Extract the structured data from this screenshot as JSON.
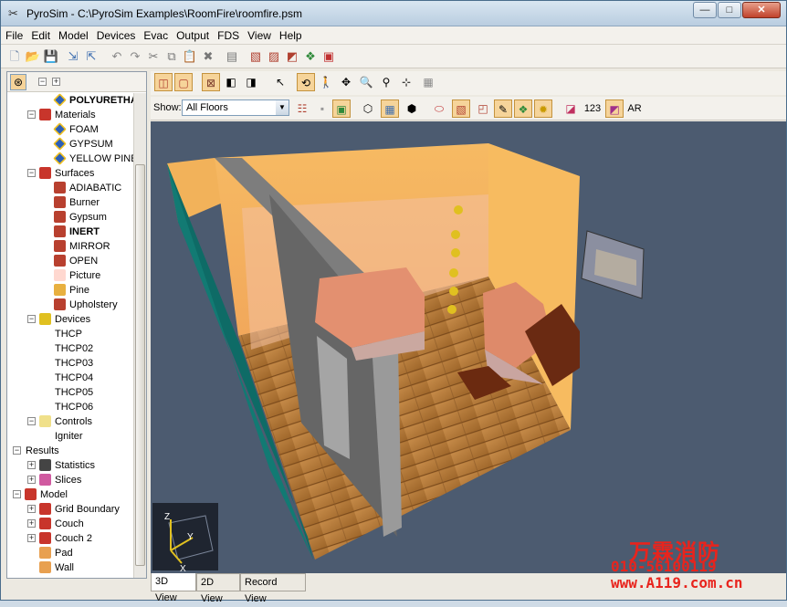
{
  "window": {
    "title": "PyroSim - C:\\PyroSim Examples\\RoomFire\\roomfire.psm",
    "min": "—",
    "max": "□",
    "close": "✕"
  },
  "menu": [
    "File",
    "Edit",
    "Model",
    "Devices",
    "Evac",
    "Output",
    "FDS",
    "View",
    "Help"
  ],
  "toolbar_icons": [
    "new-icon",
    "open-icon",
    "save-icon",
    "import-icon",
    "export-icon",
    "undo-icon",
    "redo-icon",
    "cut-icon",
    "copy-icon",
    "paste-icon",
    "delete-icon",
    "properties-icon",
    "run-fds-icon",
    "run-parallel-icon",
    "run-smokeview-icon",
    "results-icon",
    "view-results-icon"
  ],
  "tree": [
    {
      "label": "POLYURETHANE",
      "indent": 2,
      "bold": true,
      "icon": "material",
      "expander": ""
    },
    {
      "label": "Materials",
      "indent": 1,
      "icon": "materials",
      "expander": "-"
    },
    {
      "label": "FOAM",
      "indent": 2,
      "icon": "material",
      "expander": ""
    },
    {
      "label": "GYPSUM",
      "indent": 2,
      "icon": "material",
      "expander": ""
    },
    {
      "label": "YELLOW PINE",
      "indent": 2,
      "icon": "material",
      "expander": ""
    },
    {
      "label": "Surfaces",
      "indent": 1,
      "icon": "surfaces",
      "expander": "-"
    },
    {
      "label": "ADIABATIC",
      "indent": 2,
      "icon": "surface",
      "expander": ""
    },
    {
      "label": "Burner",
      "indent": 2,
      "icon": "surface",
      "expander": ""
    },
    {
      "label": "Gypsum",
      "indent": 2,
      "icon": "surface",
      "expander": ""
    },
    {
      "label": "INERT",
      "indent": 2,
      "bold": true,
      "icon": "surface",
      "expander": ""
    },
    {
      "label": "MIRROR",
      "indent": 2,
      "icon": "surface",
      "expander": ""
    },
    {
      "label": "OPEN",
      "indent": 2,
      "icon": "surface",
      "expander": ""
    },
    {
      "label": "Picture",
      "indent": 2,
      "icon": "picture",
      "expander": ""
    },
    {
      "label": "Pine",
      "indent": 2,
      "icon": "pine",
      "expander": ""
    },
    {
      "label": "Upholstery",
      "indent": 2,
      "icon": "surface",
      "expander": ""
    },
    {
      "label": "Devices",
      "indent": 1,
      "icon": "devices",
      "expander": "-"
    },
    {
      "label": "THCP",
      "indent": 2,
      "icon": "",
      "expander": ""
    },
    {
      "label": "THCP02",
      "indent": 2,
      "icon": "",
      "expander": ""
    },
    {
      "label": "THCP03",
      "indent": 2,
      "icon": "",
      "expander": ""
    },
    {
      "label": "THCP04",
      "indent": 2,
      "icon": "",
      "expander": ""
    },
    {
      "label": "THCP05",
      "indent": 2,
      "icon": "",
      "expander": ""
    },
    {
      "label": "THCP06",
      "indent": 2,
      "icon": "",
      "expander": ""
    },
    {
      "label": "Controls",
      "indent": 1,
      "icon": "controls",
      "expander": "-"
    },
    {
      "label": "Igniter",
      "indent": 2,
      "icon": "",
      "expander": ""
    },
    {
      "label": "Results",
      "indent": 0,
      "icon": "",
      "expander": "-"
    },
    {
      "label": "Statistics",
      "indent": 1,
      "icon": "statistics",
      "expander": "+"
    },
    {
      "label": "Slices",
      "indent": 1,
      "icon": "slices",
      "expander": "+"
    },
    {
      "label": "Model",
      "indent": 0,
      "icon": "model",
      "expander": "-"
    },
    {
      "label": "Grid Boundary",
      "indent": 1,
      "icon": "group",
      "expander": "+"
    },
    {
      "label": "Couch",
      "indent": 1,
      "icon": "group",
      "expander": "+"
    },
    {
      "label": "Couch 2",
      "indent": 1,
      "icon": "group",
      "expander": "+"
    },
    {
      "label": "Pad",
      "indent": 1,
      "icon": "obstruction",
      "expander": ""
    },
    {
      "label": "Wall",
      "indent": 1,
      "icon": "obstruction",
      "expander": ""
    }
  ],
  "view_toolbar": {
    "show_label": "Show:",
    "floor_value": "All Floors",
    "label_123": "123",
    "label_ar": "AR"
  },
  "tabs": [
    "3D View",
    "2D View",
    "Record View"
  ],
  "axes": {
    "z": "Z",
    "y": "Y",
    "x": "X"
  },
  "watermark": {
    "name": "万霖消防",
    "phone": "010-56100119",
    "url": "www.A119.com.cn"
  },
  "colors": {
    "accent": "#f6d49a",
    "wall_orange": "#f5b35a",
    "floor_wood": "#b87a3a",
    "viewport_bg": "#4c5b70",
    "watermark_red": "#e8241d"
  }
}
